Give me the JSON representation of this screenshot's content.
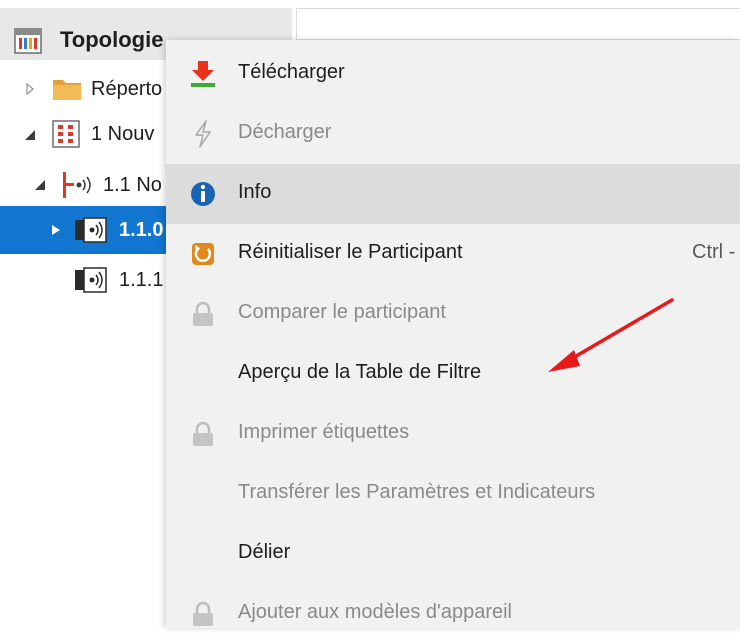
{
  "tree": {
    "header_title": "Topologie",
    "items": [
      {
        "label": "Réperto",
        "icon": "folder-icon"
      },
      {
        "label": "1 Nouv",
        "icon": "area-icon"
      },
      {
        "label": "1.1 No",
        "icon": "line-icon"
      },
      {
        "label": "1.1.0",
        "icon": "device-icon",
        "selected": true
      },
      {
        "label": "1.1.1",
        "icon": "device-icon"
      }
    ]
  },
  "menu": {
    "items": [
      {
        "label": "Télécharger",
        "icon": "download-icon",
        "enabled": true
      },
      {
        "label": "Décharger",
        "icon": "lightning-icon",
        "enabled": false
      },
      {
        "label": "Info",
        "icon": "info-icon",
        "enabled": true,
        "hover": true
      },
      {
        "label": "Réinitialiser le Participant",
        "icon": "reset-icon",
        "enabled": true,
        "shortcut": "Ctrl -"
      },
      {
        "label": "Comparer le participant",
        "icon": "lock-icon",
        "enabled": false
      },
      {
        "label": "Aperçu de la Table de Filtre",
        "icon": "",
        "enabled": true
      },
      {
        "label": "Imprimer étiquettes",
        "icon": "lock-icon",
        "enabled": false
      },
      {
        "label": "Transférer les Paramètres et Indicateurs",
        "icon": "",
        "enabled": false
      },
      {
        "label": "Délier",
        "icon": "",
        "enabled": true
      },
      {
        "label": "Ajouter aux modèles d'appareil",
        "icon": "lock-icon",
        "enabled": false
      }
    ]
  },
  "colors": {
    "selection": "#1275d0",
    "menu_bg": "#f1f1f1",
    "hover_bg": "#dcdcdc",
    "annotation_arrow": "#e8191b"
  }
}
